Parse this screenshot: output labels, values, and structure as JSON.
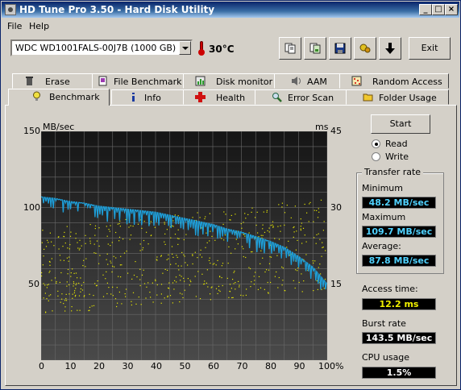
{
  "window": {
    "title": "HD Tune Pro 3.50 - Hard Disk Utility"
  },
  "menu": [
    {
      "label": "File"
    },
    {
      "label": "Help"
    }
  ],
  "toolbar": {
    "drive": "WDC WD1001FALS-00J7B (1000 GB)",
    "temperature": "30°C",
    "exit_label": "Exit"
  },
  "tabs_top": [
    {
      "label": "Erase"
    },
    {
      "label": "File Benchmark"
    },
    {
      "label": "Disk monitor"
    },
    {
      "label": "AAM"
    },
    {
      "label": "Random Access"
    }
  ],
  "tabs_bottom": [
    {
      "label": "Benchmark"
    },
    {
      "label": "Info"
    },
    {
      "label": "Health"
    },
    {
      "label": "Error Scan"
    },
    {
      "label": "Folder Usage"
    }
  ],
  "benchmark": {
    "start_label": "Start",
    "read_label": "Read",
    "write_label": "Write",
    "transfer_rate_label": "Transfer rate",
    "minimum_label": "Minimum",
    "minimum_value": "48.2 MB/sec",
    "maximum_label": "Maximum",
    "maximum_value": "109.7 MB/sec",
    "average_label": "Average:",
    "average_value": "87.8 MB/sec",
    "access_time_label": "Access time:",
    "access_time_value": "12.2 ms",
    "burst_rate_label": "Burst rate",
    "burst_rate_value": "143.5 MB/sec",
    "cpu_usage_label": "CPU usage",
    "cpu_usage_value": "1.5%"
  },
  "chart_data": {
    "type": "line",
    "ylabel": "MB/sec",
    "y2label": "ms",
    "ylim": [
      0,
      150
    ],
    "y2lim": [
      0,
      45
    ],
    "y_ticks": [
      "150",
      "100",
      "50"
    ],
    "y2_ticks": [
      "45",
      "30",
      "15"
    ],
    "x_ticks": [
      "0",
      "10",
      "20",
      "30",
      "40",
      "50",
      "60",
      "70",
      "80",
      "90",
      "100%"
    ],
    "colors": {
      "transfer": "#1e9ed8",
      "access": "#e8e800",
      "background": "#2a2a2a",
      "grid": "#6a6a6a"
    },
    "series": [
      {
        "x": [
          0,
          5,
          10,
          15,
          20,
          25,
          30,
          35,
          40,
          45,
          50,
          55,
          60,
          65,
          70,
          75,
          80,
          85,
          90,
          95,
          100
        ],
        "values": [
          107,
          106,
          104,
          103,
          101,
          100,
          99,
          98,
          97,
          95,
          93,
          91,
          89,
          86,
          84,
          81,
          78,
          74,
          68,
          61,
          50
        ]
      }
    ],
    "access_time_ms": {
      "x_range": [
        0,
        100
      ],
      "min_ms_start": 9,
      "max_ms_start": 26,
      "min_ms_end": 14,
      "max_ms_end": 32
    }
  }
}
